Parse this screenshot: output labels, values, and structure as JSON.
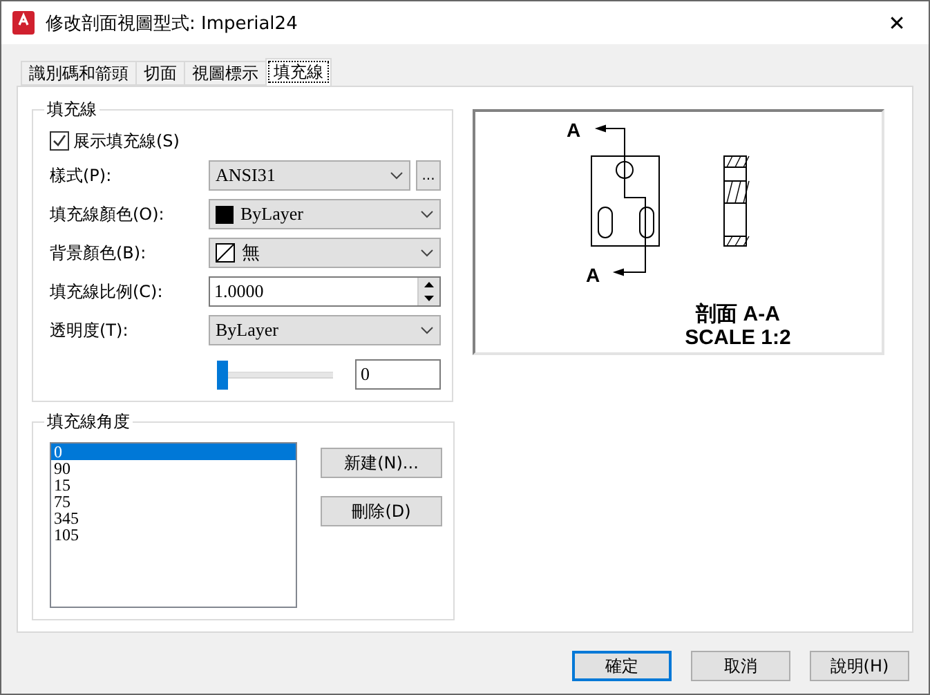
{
  "window": {
    "title": "修改剖面視圖型式: Imperial24",
    "close": "✕"
  },
  "tabs": [
    {
      "label": "識別碼和箭頭",
      "selected": false
    },
    {
      "label": "切面",
      "selected": false
    },
    {
      "label": "視圖標示",
      "selected": false
    },
    {
      "label": "填充線",
      "selected": true
    }
  ],
  "hatch": {
    "title": "填充線",
    "show_hatch": {
      "label": "展示填充線(S)",
      "checked": true
    },
    "pattern": {
      "label": "樣式(P):",
      "value": "ANSI31",
      "browse": "..."
    },
    "color": {
      "label": "填充線顏色(O):",
      "value": "ByLayer"
    },
    "background": {
      "label": "背景顏色(B):",
      "value": "無"
    },
    "scale": {
      "label": "填充線比例(C):",
      "value": "1.0000"
    },
    "transparency": {
      "label": "透明度(T):",
      "value": "ByLayer",
      "level": 0,
      "reading": "0"
    }
  },
  "angles": {
    "title": "填充線角度",
    "items": [
      {
        "label": "0",
        "selected": true
      },
      {
        "label": "90",
        "selected": false
      },
      {
        "label": "15",
        "selected": false
      },
      {
        "label": "75",
        "selected": false
      },
      {
        "label": "345",
        "selected": false
      },
      {
        "label": "105",
        "selected": false
      }
    ],
    "new_button": "新建(N)...",
    "delete_button": "刪除(D)"
  },
  "preview": {
    "marks": [
      "A",
      "A"
    ],
    "caption": [
      "剖面 A-A",
      "SCALE 1:2"
    ]
  },
  "buttons": [
    {
      "label": "確定",
      "focused": true
    },
    {
      "label": "取消",
      "focused": false
    },
    {
      "label": "說明(H)",
      "focused": false
    }
  ]
}
